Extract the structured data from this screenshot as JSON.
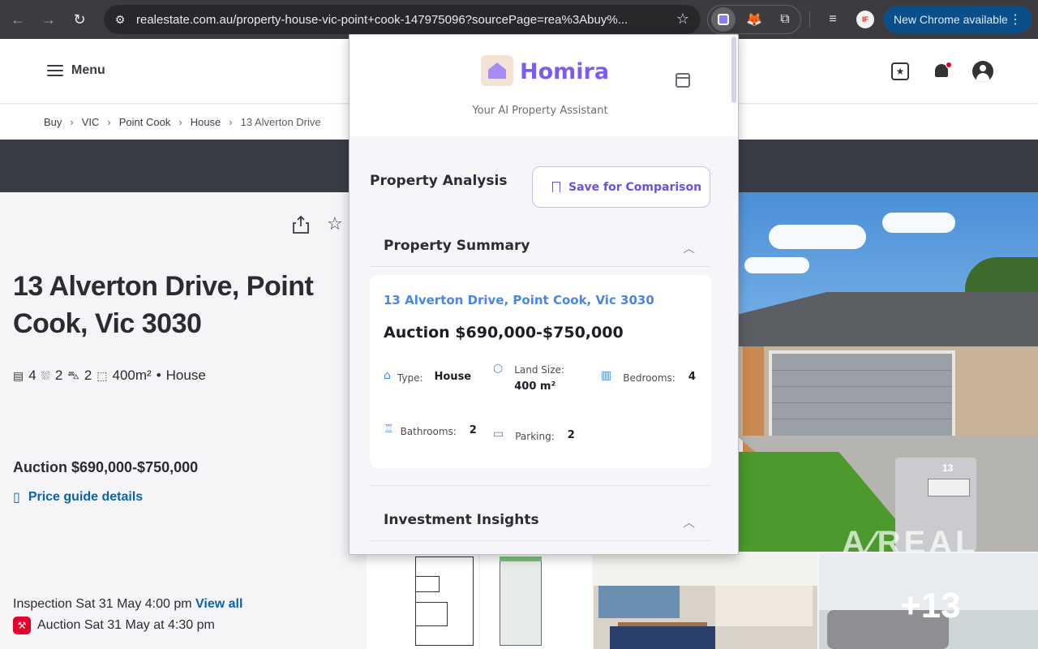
{
  "browser": {
    "url": "realestate.com.au/property-house-vic-point+cook-147975096?sourcePage=rea%3Abuy%...",
    "update_label": "New Chrome available",
    "profile_initials": "IF"
  },
  "site": {
    "menu_label": "Menu",
    "breadcrumb": [
      "Buy",
      "VIC",
      "Point Cook",
      "House",
      "13 Alverton Drive"
    ]
  },
  "property": {
    "title": "13 Alverton Drive, Point Cook, Vic 3030",
    "bedrooms": "4",
    "bathrooms": "2",
    "parking": "2",
    "land": "400m²",
    "type": "House",
    "price": "Auction $690,000-$750,000",
    "price_guide_label": "Price guide details",
    "inspection_text": "Inspection Sat 31 May 4:00 pm",
    "view_all_label": "View all",
    "auction_text": "Auction Sat 31 May at 4:30 pm",
    "more_photos": "+13",
    "mailbox_number": "13",
    "photo_watermark": "A∕REAL"
  },
  "homira": {
    "brand": "Homira",
    "tagline": "Your AI Property Assistant",
    "analysis_title": "Property Analysis",
    "save_label": "Save for Comparison",
    "summary_title": "Property Summary",
    "address": "13 Alverton Drive, Point Cook, Vic 3030",
    "price": "Auction $690,000-$750,000",
    "type_label": "Type:",
    "type_value": "House",
    "land_label": "Land Size:",
    "land_value": "400 m²",
    "bedrooms_label": "Bedrooms:",
    "bedrooms_value": "4",
    "bathrooms_label": "Bathrooms:",
    "bathrooms_value": "2",
    "parking_label": "Parking:",
    "parking_value": "2",
    "insights_title": "Investment Insights"
  },
  "colors": {
    "brand_purple": "#7c5cf0",
    "link_blue": "#0d63a8",
    "accent_red": "#e4002b"
  }
}
